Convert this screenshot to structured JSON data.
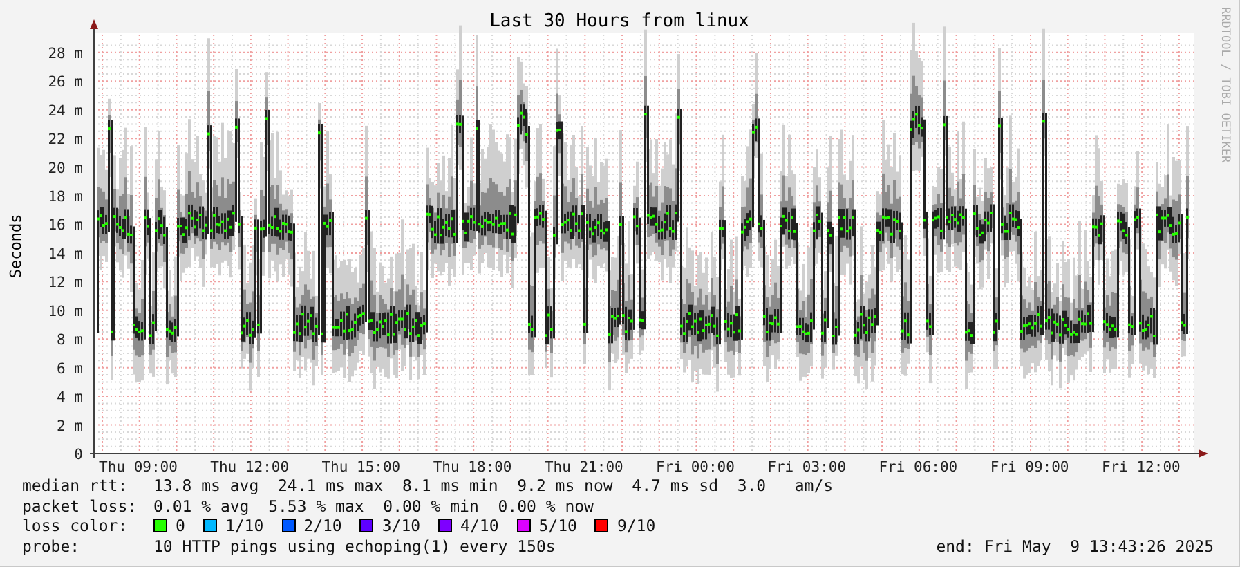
{
  "title": "Last 30 Hours from linux",
  "credit": "RRDTOOL / TOBI OETIKER",
  "y_axis": {
    "label": "Seconds",
    "ticks": [
      "28 m",
      "26 m",
      "24 m",
      "22 m",
      "20 m",
      "18 m",
      "16 m",
      "14 m",
      "12 m",
      "10 m",
      "8 m",
      "6 m",
      "4 m",
      "2 m",
      "0"
    ]
  },
  "x_axis": {
    "ticks": [
      "Thu 09:00",
      "Thu 12:00",
      "Thu 15:00",
      "Thu 18:00",
      "Thu 21:00",
      "Fri 00:00",
      "Fri 03:00",
      "Fri 06:00",
      "Fri 09:00",
      "Fri 12:00"
    ]
  },
  "legend": [
    {
      "label": "median rtt:",
      "text": "13.8 ms avg  24.1 ms max  8.1 ms min  9.2 ms now  4.7 ms sd  3.0   am/s"
    },
    {
      "label": "packet loss:",
      "text": "0.01 % avg  5.53 % max  0.00 % min  0.00 % now"
    }
  ],
  "loss_colors": {
    "label": "loss color:",
    "items": [
      {
        "label": "0",
        "color": "#26ff00"
      },
      {
        "label": "1/10",
        "color": "#00b8ff"
      },
      {
        "label": "2/10",
        "color": "#0059ff"
      },
      {
        "label": "3/10",
        "color": "#5e00ff"
      },
      {
        "label": "4/10",
        "color": "#7e00ff"
      },
      {
        "label": "5/10",
        "color": "#dd00ff"
      },
      {
        "label": "9/10",
        "color": "#ff0000"
      }
    ]
  },
  "probe": {
    "label": "probe:",
    "text": "10 HTTP pings using echoping(1) every 150s",
    "end": "end: Fri May  9 13:43:26 2025"
  }
}
